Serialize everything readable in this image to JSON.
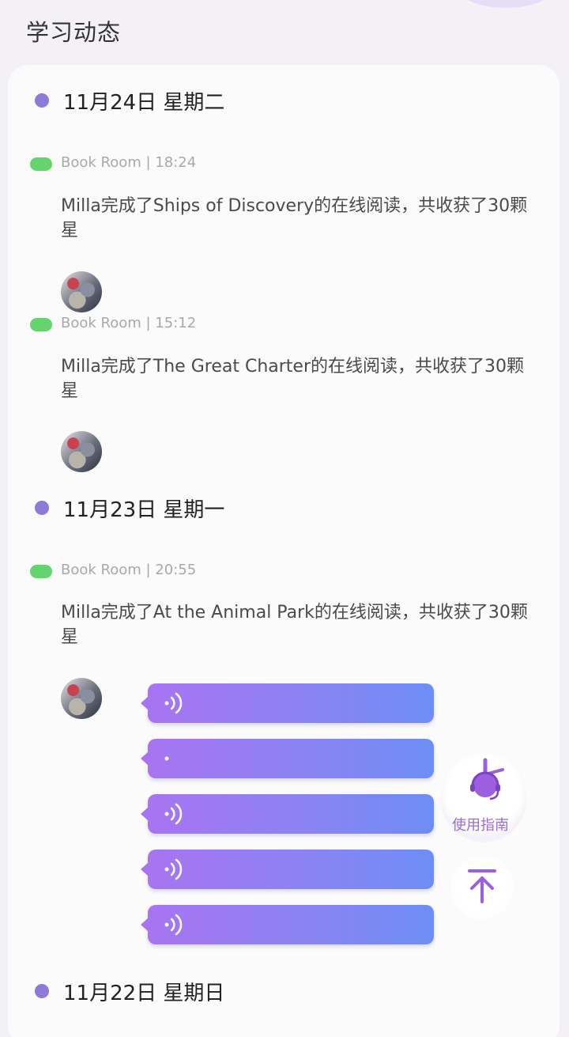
{
  "page": {
    "title": "学习动态"
  },
  "days": [
    {
      "label": "11月24日  星期二"
    },
    {
      "label": "11月23日  星期一"
    },
    {
      "label": "11月22日  星期日"
    }
  ],
  "entries": [
    {
      "meta": "Book Room | 18:24",
      "text": "Milla完成了Ships of Discovery的在线阅读，共收获了30颗星"
    },
    {
      "meta": "Book Room | 15:12",
      "text": "Milla完成了The Great Charter的在线阅读，共收获了30颗星"
    },
    {
      "meta": "Book Room | 20:55",
      "text": "Milla完成了At the Animal Park的在线阅读，共收获了30颗星"
    }
  ],
  "voice_messages": [
    {
      "icon": "sound-wave-icon"
    },
    {
      "icon": "sound-dot-icon"
    },
    {
      "icon": "sound-wave-icon"
    },
    {
      "icon": "sound-wave-icon"
    },
    {
      "icon": "sound-wave-icon"
    }
  ],
  "floating": {
    "guide_label": "使用指南",
    "guide_icon": "headset-robot-icon",
    "top_icon": "arrow-up-to-top-icon"
  },
  "colors": {
    "accent_purple": "#8d7ad9",
    "tag_green": "#66d46e",
    "voice_gradient_start": "#a874f2",
    "voice_gradient_end": "#6d8ef5"
  }
}
